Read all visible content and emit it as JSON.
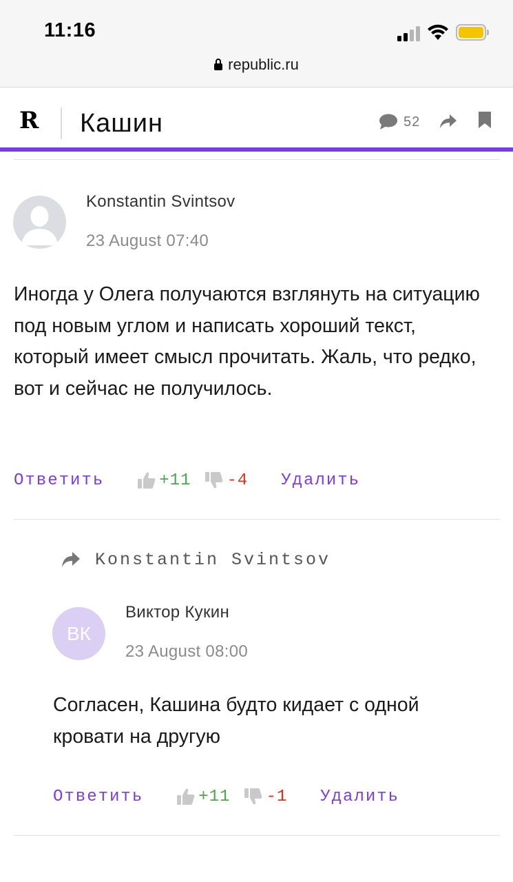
{
  "status_bar": {
    "time": "11:16",
    "url": "republic.ru"
  },
  "header": {
    "logo": "R",
    "title": "Кашин",
    "comment_count": "52"
  },
  "comments": [
    {
      "author": "Konstantin Svintsov",
      "date": "23 August 07:40",
      "text": "Иногда у Олега получаются взглянуть на ситуацию под новым углом и написать хороший текст, который имеет смысл прочитать. Жаль, что редко, вот и сейчас не получилось.",
      "reply_label": "Ответить",
      "likes": "+11",
      "dislikes": "-4",
      "delete_label": "Удалить"
    },
    {
      "reply_to": "Konstantin Svintsov",
      "author": "Виктор Кукин",
      "initials": "ВК",
      "date": "23 August 08:00",
      "text": "Согласен, Кашина будто кидает с одной кровати на другую",
      "reply_label": "Ответить",
      "likes": "+11",
      "dislikes": "-1",
      "delete_label": "Удалить"
    }
  ],
  "colors": {
    "accent": "#7a3ee0",
    "positive": "#4ca64c",
    "negative": "#e0301e",
    "avatar_initials_bg": "#dccff4"
  }
}
